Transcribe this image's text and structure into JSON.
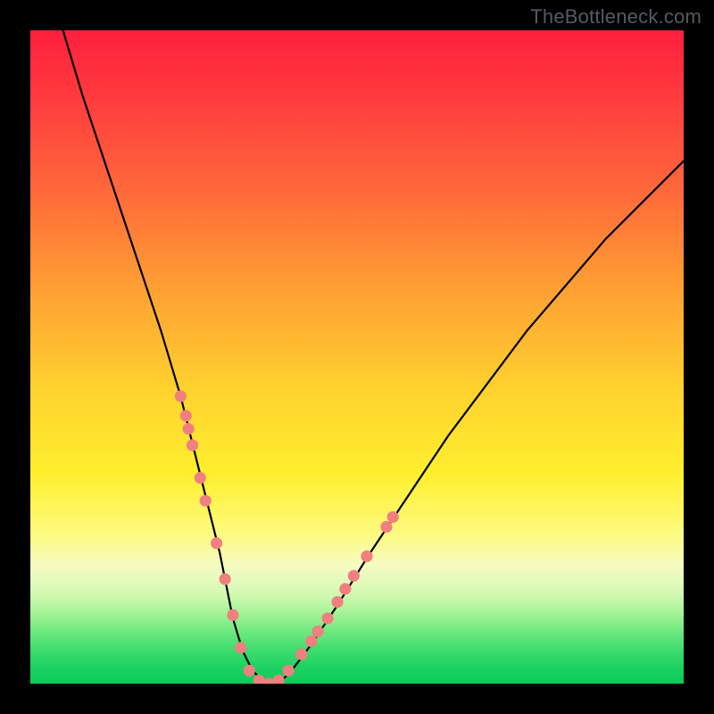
{
  "watermark": "TheBottleneck.com",
  "chart_data": {
    "type": "line",
    "title": "",
    "xlabel": "",
    "ylabel": "",
    "xlim": [
      0,
      100
    ],
    "ylim": [
      0,
      100
    ],
    "grid": false,
    "legend": false,
    "series": [
      {
        "name": "curve",
        "color": "#000000",
        "x": [
          5,
          8,
          12,
          16,
          20,
          23,
          25,
          27,
          29,
          30,
          31,
          32.5,
          34,
          36,
          38,
          40,
          43,
          47,
          52,
          58,
          64,
          70,
          76,
          82,
          88,
          94,
          100
        ],
        "y": [
          100,
          90,
          78,
          66,
          54,
          44,
          36,
          28,
          20,
          15,
          10,
          5,
          2,
          0,
          0,
          2,
          6,
          12,
          20,
          29,
          38,
          46,
          54,
          61,
          68,
          74,
          80
        ]
      }
    ],
    "markers": {
      "name": "highlighted-points",
      "color": "#f08080",
      "radius_pct": 0.9,
      "points": [
        {
          "x": 23.0,
          "y": 44.0
        },
        {
          "x": 23.8,
          "y": 41.0
        },
        {
          "x": 24.2,
          "y": 39.0
        },
        {
          "x": 24.8,
          "y": 36.5
        },
        {
          "x": 26.0,
          "y": 31.5
        },
        {
          "x": 26.8,
          "y": 28.0
        },
        {
          "x": 28.5,
          "y": 21.5
        },
        {
          "x": 29.8,
          "y": 16.0
        },
        {
          "x": 31.0,
          "y": 10.5
        },
        {
          "x": 32.2,
          "y": 5.5
        },
        {
          "x": 33.5,
          "y": 2.0
        },
        {
          "x": 35.0,
          "y": 0.5
        },
        {
          "x": 36.5,
          "y": 0.0
        },
        {
          "x": 38.0,
          "y": 0.5
        },
        {
          "x": 39.5,
          "y": 2.0
        },
        {
          "x": 41.5,
          "y": 4.5
        },
        {
          "x": 43.0,
          "y": 6.5
        },
        {
          "x": 44.0,
          "y": 8.0
        },
        {
          "x": 45.5,
          "y": 10.0
        },
        {
          "x": 47.0,
          "y": 12.5
        },
        {
          "x": 48.2,
          "y": 14.5
        },
        {
          "x": 49.5,
          "y": 16.5
        },
        {
          "x": 51.5,
          "y": 19.5
        },
        {
          "x": 54.5,
          "y": 24.0
        },
        {
          "x": 55.5,
          "y": 25.5
        }
      ]
    },
    "background": {
      "type": "vertical-gradient",
      "stops": [
        {
          "pct": 0,
          "color": "#ff1f3d"
        },
        {
          "pct": 25,
          "color": "#ff6a3a"
        },
        {
          "pct": 55,
          "color": "#ffd22e"
        },
        {
          "pct": 82,
          "color": "#f6fbc3"
        },
        {
          "pct": 100,
          "color": "#0ecb5a"
        }
      ]
    }
  }
}
